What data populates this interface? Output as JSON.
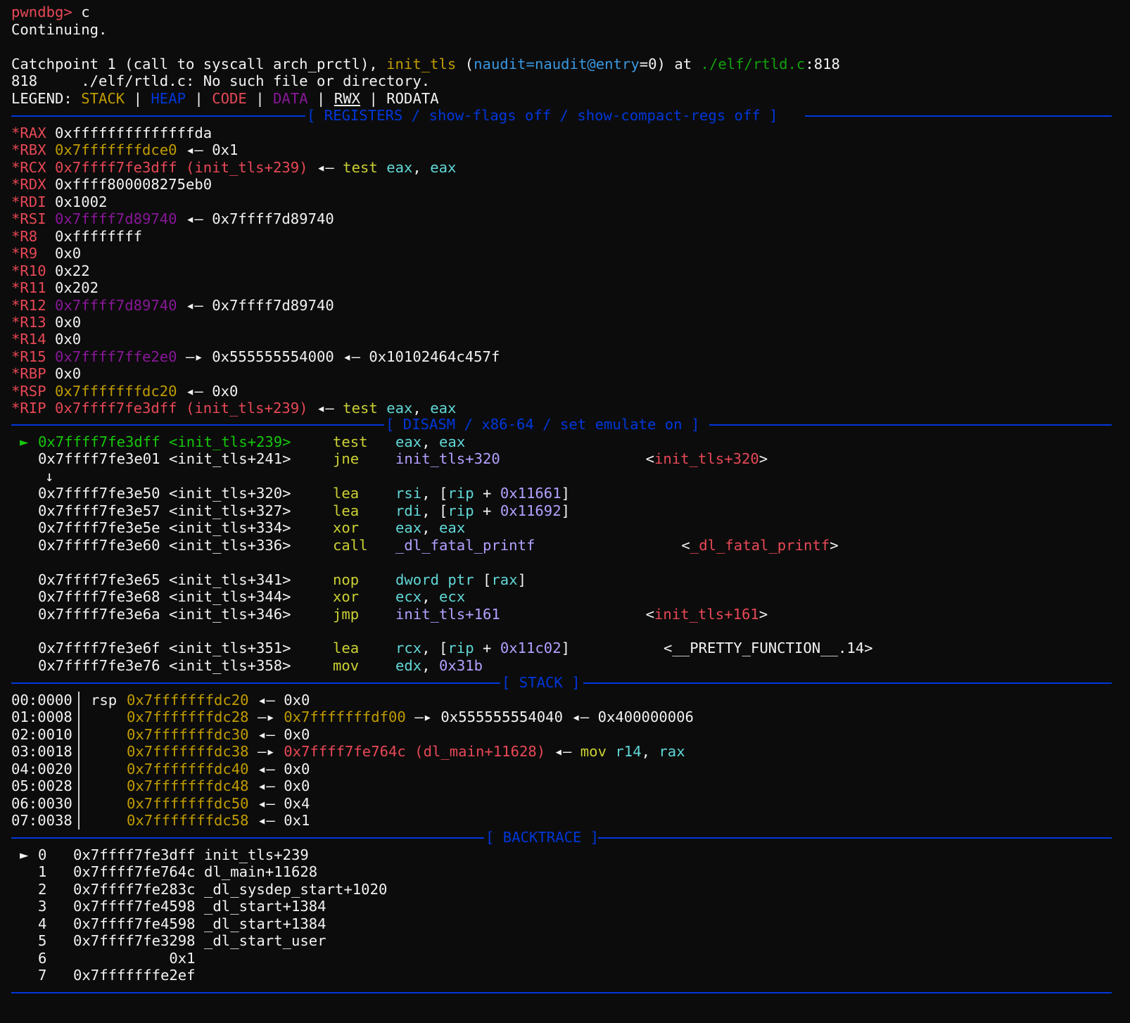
{
  "header": {
    "prompt": "pwndbg>",
    "command": " c",
    "continuing": "Continuing.",
    "catch_prefix": "Catchpoint 1 (call to syscall arch_prctl), ",
    "catch_func": "init_tls",
    "catch_paren_open": " (",
    "catch_arg": "naudit=naudit@entry",
    "catch_arg_val": "=0",
    "catch_at": ") at ",
    "catch_file": "./elf/rtld.c",
    "catch_line": ":818",
    "source_msg": "818\t./elf/rtld.c: No such file or directory."
  },
  "legend": {
    "label": "LEGEND: ",
    "stack": "STACK",
    "heap": "HEAP",
    "code": "CODE",
    "data": "DATA",
    "rwx": "RWX",
    "rodata": "RODATA",
    "sep": " | "
  },
  "sections": {
    "registers": "[ REGISTERS / show-flags off / show-compact-regs off ]",
    "disasm": "[ DISASM / x86-64 / set emulate on ]",
    "stack": "[ STACK ]",
    "backtrace": "[ BACKTRACE ]"
  },
  "registers": [
    {
      "name": "*RAX",
      "parts": [
        {
          "t": "0xffffffffffffffda",
          "c": "white"
        }
      ]
    },
    {
      "name": "*RBX",
      "parts": [
        {
          "t": "0x7fffffffdce0",
          "c": "yel"
        },
        {
          "t": " ◂— 0x1",
          "c": ""
        }
      ]
    },
    {
      "name": "*RCX",
      "parts": [
        {
          "t": "0x7ffff7fe3dff (init_tls+239)",
          "c": "red"
        },
        {
          "t": " ◂— ",
          "c": ""
        },
        {
          "t": "test",
          "c": "lyel"
        },
        {
          "t": " ",
          "c": ""
        },
        {
          "t": "eax",
          "c": "cyan"
        },
        {
          "t": ", ",
          "c": ""
        },
        {
          "t": "eax",
          "c": "cyan"
        }
      ]
    },
    {
      "name": "*RDX",
      "parts": [
        {
          "t": "0xffff800008275eb0",
          "c": "white"
        }
      ]
    },
    {
      "name": "*RDI",
      "parts": [
        {
          "t": "0x1002",
          "c": "white"
        }
      ]
    },
    {
      "name": "*RSI",
      "parts": [
        {
          "t": "0x7ffff7d89740",
          "c": "purp"
        },
        {
          "t": " ◂— 0x7ffff7d89740",
          "c": ""
        }
      ]
    },
    {
      "name": "*R8",
      "parts": [
        {
          "t": "0xffffffff",
          "c": "white"
        }
      ]
    },
    {
      "name": "*R9",
      "parts": [
        {
          "t": "0x0",
          "c": "white"
        }
      ]
    },
    {
      "name": "*R10",
      "parts": [
        {
          "t": "0x22",
          "c": "white"
        }
      ]
    },
    {
      "name": "*R11",
      "parts": [
        {
          "t": "0x202",
          "c": "white"
        }
      ]
    },
    {
      "name": "*R12",
      "parts": [
        {
          "t": "0x7ffff7d89740",
          "c": "purp"
        },
        {
          "t": " ◂— 0x7ffff7d89740",
          "c": ""
        }
      ]
    },
    {
      "name": "*R13",
      "parts": [
        {
          "t": "0x0",
          "c": "white"
        }
      ]
    },
    {
      "name": "*R14",
      "parts": [
        {
          "t": "0x0",
          "c": "white"
        }
      ]
    },
    {
      "name": "*R15",
      "parts": [
        {
          "t": "0x7ffff7ffe2e0",
          "c": "purp"
        },
        {
          "t": " —▸ 0x555555554000 ◂— 0x10102464c457f",
          "c": ""
        }
      ]
    },
    {
      "name": "*RBP",
      "parts": [
        {
          "t": "0x0",
          "c": "white"
        }
      ]
    },
    {
      "name": "*RSP",
      "parts": [
        {
          "t": "0x7fffffffdc20",
          "c": "yel"
        },
        {
          "t": " ◂— 0x0",
          "c": ""
        }
      ]
    },
    {
      "name": "*RIP",
      "parts": [
        {
          "t": "0x7ffff7fe3dff (init_tls+239)",
          "c": "red"
        },
        {
          "t": " ◂— ",
          "c": ""
        },
        {
          "t": "test",
          "c": "lyel"
        },
        {
          "t": " ",
          "c": ""
        },
        {
          "t": "eax",
          "c": "cyan"
        },
        {
          "t": ", ",
          "c": ""
        },
        {
          "t": "eax",
          "c": "cyan"
        }
      ]
    }
  ],
  "disasm": [
    {
      "cur": true,
      "addr": "0x7ffff7fe3dff",
      "sym": "<init_tls+239>",
      "mn": "test",
      "ops": [
        {
          "t": "eax",
          "c": "cyan"
        },
        {
          "t": ", ",
          "c": ""
        },
        {
          "t": "eax",
          "c": "cyan"
        }
      ],
      "note": []
    },
    {
      "addr": "0x7ffff7fe3e01",
      "sym": "<init_tls+241>",
      "mn": "jne",
      "ops": [
        {
          "t": "init_tls+320",
          "c": "lpurp"
        }
      ],
      "note": [
        {
          "t": "<",
          "c": ""
        },
        {
          "t": "init_tls+320",
          "c": "red"
        },
        {
          "t": ">",
          "c": ""
        }
      ],
      "note_pad": 28
    },
    {
      "arrow": "↓"
    },
    {
      "addr": "0x7ffff7fe3e50",
      "sym": "<init_tls+320>",
      "mn": "lea",
      "ops": [
        {
          "t": "rsi",
          "c": "cyan"
        },
        {
          "t": ", [",
          "c": ""
        },
        {
          "t": "rip",
          "c": "cyan"
        },
        {
          "t": " + ",
          "c": ""
        },
        {
          "t": "0x11661",
          "c": "lpurp"
        },
        {
          "t": "]",
          "c": ""
        }
      ],
      "note": []
    },
    {
      "addr": "0x7ffff7fe3e57",
      "sym": "<init_tls+327>",
      "mn": "lea",
      "ops": [
        {
          "t": "rdi",
          "c": "cyan"
        },
        {
          "t": ", [",
          "c": ""
        },
        {
          "t": "rip",
          "c": "cyan"
        },
        {
          "t": " + ",
          "c": ""
        },
        {
          "t": "0x11692",
          "c": "lpurp"
        },
        {
          "t": "]",
          "c": ""
        }
      ],
      "note": []
    },
    {
      "addr": "0x7ffff7fe3e5e",
      "sym": "<init_tls+334>",
      "mn": "xor",
      "ops": [
        {
          "t": "eax",
          "c": "cyan"
        },
        {
          "t": ", ",
          "c": ""
        },
        {
          "t": "eax",
          "c": "cyan"
        }
      ],
      "note": []
    },
    {
      "addr": "0x7ffff7fe3e60",
      "sym": "<init_tls+336>",
      "mn": "call",
      "ops": [
        {
          "t": "_dl_fatal_printf",
          "c": "lpurp"
        }
      ],
      "note": [
        {
          "t": "<",
          "c": ""
        },
        {
          "t": "_dl_fatal_printf",
          "c": "red"
        },
        {
          "t": ">",
          "c": ""
        }
      ],
      "note_pad": 32
    },
    {
      "blank": true
    },
    {
      "addr": "0x7ffff7fe3e65",
      "sym": "<init_tls+341>",
      "mn": "nop",
      "ops": [
        {
          "t": "dword ptr",
          "c": "cyan"
        },
        {
          "t": " [",
          "c": ""
        },
        {
          "t": "rax",
          "c": "cyan"
        },
        {
          "t": "]",
          "c": ""
        }
      ],
      "note": []
    },
    {
      "addr": "0x7ffff7fe3e68",
      "sym": "<init_tls+344>",
      "mn": "xor",
      "ops": [
        {
          "t": "ecx",
          "c": "cyan"
        },
        {
          "t": ", ",
          "c": ""
        },
        {
          "t": "ecx",
          "c": "cyan"
        }
      ],
      "note": []
    },
    {
      "addr": "0x7ffff7fe3e6a",
      "sym": "<init_tls+346>",
      "mn": "jmp",
      "ops": [
        {
          "t": "init_tls+161",
          "c": "lpurp"
        }
      ],
      "note": [
        {
          "t": "<",
          "c": ""
        },
        {
          "t": "init_tls+161",
          "c": "red"
        },
        {
          "t": ">",
          "c": ""
        }
      ],
      "note_pad": 28
    },
    {
      "blank": true
    },
    {
      "addr": "0x7ffff7fe3e6f",
      "sym": "<init_tls+351>",
      "mn": "lea",
      "ops": [
        {
          "t": "rcx",
          "c": "cyan"
        },
        {
          "t": ", [",
          "c": ""
        },
        {
          "t": "rip",
          "c": "cyan"
        },
        {
          "t": " + ",
          "c": ""
        },
        {
          "t": "0x11c02",
          "c": "lpurp"
        },
        {
          "t": "]",
          "c": ""
        }
      ],
      "note": [
        {
          "t": "<__PRETTY_FUNCTION__.14>",
          "c": ""
        }
      ],
      "note_pad": 30
    },
    {
      "addr": "0x7ffff7fe3e76",
      "sym": "<init_tls+358>",
      "mn": "mov",
      "ops": [
        {
          "t": "edx",
          "c": "cyan"
        },
        {
          "t": ", ",
          "c": ""
        },
        {
          "t": "0x31b",
          "c": "lpurp"
        }
      ],
      "note": []
    }
  ],
  "stack": [
    {
      "idx": "00:0000",
      "reg": "rsp",
      "parts": [
        {
          "t": "0x7fffffffdc20",
          "c": "yel"
        },
        {
          "t": " ◂— 0x0",
          "c": ""
        }
      ]
    },
    {
      "idx": "01:0008",
      "reg": "",
      "parts": [
        {
          "t": "0x7fffffffdc28",
          "c": "yel"
        },
        {
          "t": " —▸ ",
          "c": ""
        },
        {
          "t": "0x7fffffffdf00",
          "c": "yel"
        },
        {
          "t": " —▸ 0x555555554040 ◂— 0x400000006",
          "c": ""
        }
      ]
    },
    {
      "idx": "02:0010",
      "reg": "",
      "parts": [
        {
          "t": "0x7fffffffdc30",
          "c": "yel"
        },
        {
          "t": " ◂— 0x0",
          "c": ""
        }
      ]
    },
    {
      "idx": "03:0018",
      "reg": "",
      "parts": [
        {
          "t": "0x7fffffffdc38",
          "c": "yel"
        },
        {
          "t": " —▸ ",
          "c": ""
        },
        {
          "t": "0x7ffff7fe764c (dl_main+11628)",
          "c": "red"
        },
        {
          "t": " ◂— ",
          "c": ""
        },
        {
          "t": "mov",
          "c": "lyel"
        },
        {
          "t": " ",
          "c": ""
        },
        {
          "t": "r14",
          "c": "cyan"
        },
        {
          "t": ", ",
          "c": ""
        },
        {
          "t": "rax",
          "c": "cyan"
        }
      ]
    },
    {
      "idx": "04:0020",
      "reg": "",
      "parts": [
        {
          "t": "0x7fffffffdc40",
          "c": "yel"
        },
        {
          "t": " ◂— 0x0",
          "c": ""
        }
      ]
    },
    {
      "idx": "05:0028",
      "reg": "",
      "parts": [
        {
          "t": "0x7fffffffdc48",
          "c": "yel"
        },
        {
          "t": " ◂— 0x0",
          "c": ""
        }
      ]
    },
    {
      "idx": "06:0030",
      "reg": "",
      "parts": [
        {
          "t": "0x7fffffffdc50",
          "c": "yel"
        },
        {
          "t": " ◂— 0x4",
          "c": ""
        }
      ]
    },
    {
      "idx": "07:0038",
      "reg": "",
      "parts": [
        {
          "t": "0x7fffffffdc58",
          "c": "yel"
        },
        {
          "t": " ◂— 0x1",
          "c": ""
        }
      ]
    }
  ],
  "backtrace": [
    {
      "cur": true,
      "idx": "0",
      "addr": "0x7ffff7fe3dff",
      "sym": "init_tls+239"
    },
    {
      "idx": "1",
      "addr": "0x7ffff7fe764c",
      "sym": "dl_main+11628"
    },
    {
      "idx": "2",
      "addr": "0x7ffff7fe283c",
      "sym": "_dl_sysdep_start+1020"
    },
    {
      "idx": "3",
      "addr": "0x7ffff7fe4598",
      "sym": "_dl_start+1384"
    },
    {
      "idx": "4",
      "addr": "0x7ffff7fe4598",
      "sym": "_dl_start+1384"
    },
    {
      "idx": "5",
      "addr": "0x7ffff7fe3298",
      "sym": "_dl_start_user"
    },
    {
      "idx": "6",
      "addr": "0x1",
      "sym": ""
    },
    {
      "idx": "7",
      "addr": "0x7fffffffe2ef",
      "sym": ""
    }
  ],
  "markers": {
    "current": "►"
  },
  "colors": {
    "background": "#0c0c0c",
    "foreground": "#cccccc",
    "separator": "#0037da",
    "stack": "#c19c00",
    "heap": "#0037da",
    "code": "#e74856",
    "data": "#881798"
  }
}
